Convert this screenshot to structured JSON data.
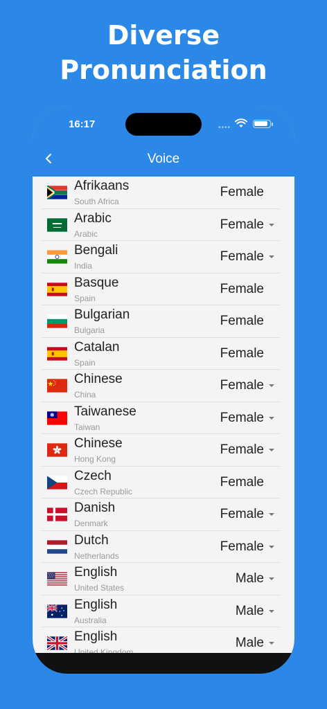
{
  "promo": {
    "line1": "Diverse",
    "line2": "Pronunciation"
  },
  "status_bar": {
    "time": "16:17"
  },
  "nav": {
    "title": "Voice",
    "back_icon": "chevron-left-icon"
  },
  "colors": {
    "brand": "#2b88e6",
    "list_bg": "#f4f4f4"
  },
  "voices": [
    {
      "language": "Afrikaans",
      "region": "South Africa",
      "gender": "Female",
      "dropdown": false,
      "flag": "za"
    },
    {
      "language": "Arabic",
      "region": "Arabic",
      "gender": "Female",
      "dropdown": true,
      "flag": "sa"
    },
    {
      "language": "Bengali",
      "region": "India",
      "gender": "Female",
      "dropdown": true,
      "flag": "in"
    },
    {
      "language": "Basque",
      "region": "Spain",
      "gender": "Female",
      "dropdown": false,
      "flag": "es"
    },
    {
      "language": "Bulgarian",
      "region": "Bulgaria",
      "gender": "Female",
      "dropdown": false,
      "flag": "bg"
    },
    {
      "language": "Catalan",
      "region": "Spain",
      "gender": "Female",
      "dropdown": false,
      "flag": "es"
    },
    {
      "language": "Chinese",
      "region": "China",
      "gender": "Female",
      "dropdown": true,
      "flag": "cn"
    },
    {
      "language": "Taiwanese",
      "region": "Taiwan",
      "gender": "Female",
      "dropdown": true,
      "flag": "tw"
    },
    {
      "language": "Chinese",
      "region": "Hong Kong",
      "gender": "Female",
      "dropdown": true,
      "flag": "hk"
    },
    {
      "language": "Czech",
      "region": "Czech Republic",
      "gender": "Female",
      "dropdown": false,
      "flag": "cz"
    },
    {
      "language": "Danish",
      "region": "Denmark",
      "gender": "Female",
      "dropdown": true,
      "flag": "dk"
    },
    {
      "language": "Dutch",
      "region": "Netherlands",
      "gender": "Female",
      "dropdown": true,
      "flag": "nl"
    },
    {
      "language": "English",
      "region": "United States",
      "gender": "Male",
      "dropdown": true,
      "flag": "us"
    },
    {
      "language": "English",
      "region": "Australia",
      "gender": "Male",
      "dropdown": true,
      "flag": "au"
    },
    {
      "language": "English",
      "region": "United Kingdom",
      "gender": "Male",
      "dropdown": true,
      "flag": "gb"
    }
  ]
}
